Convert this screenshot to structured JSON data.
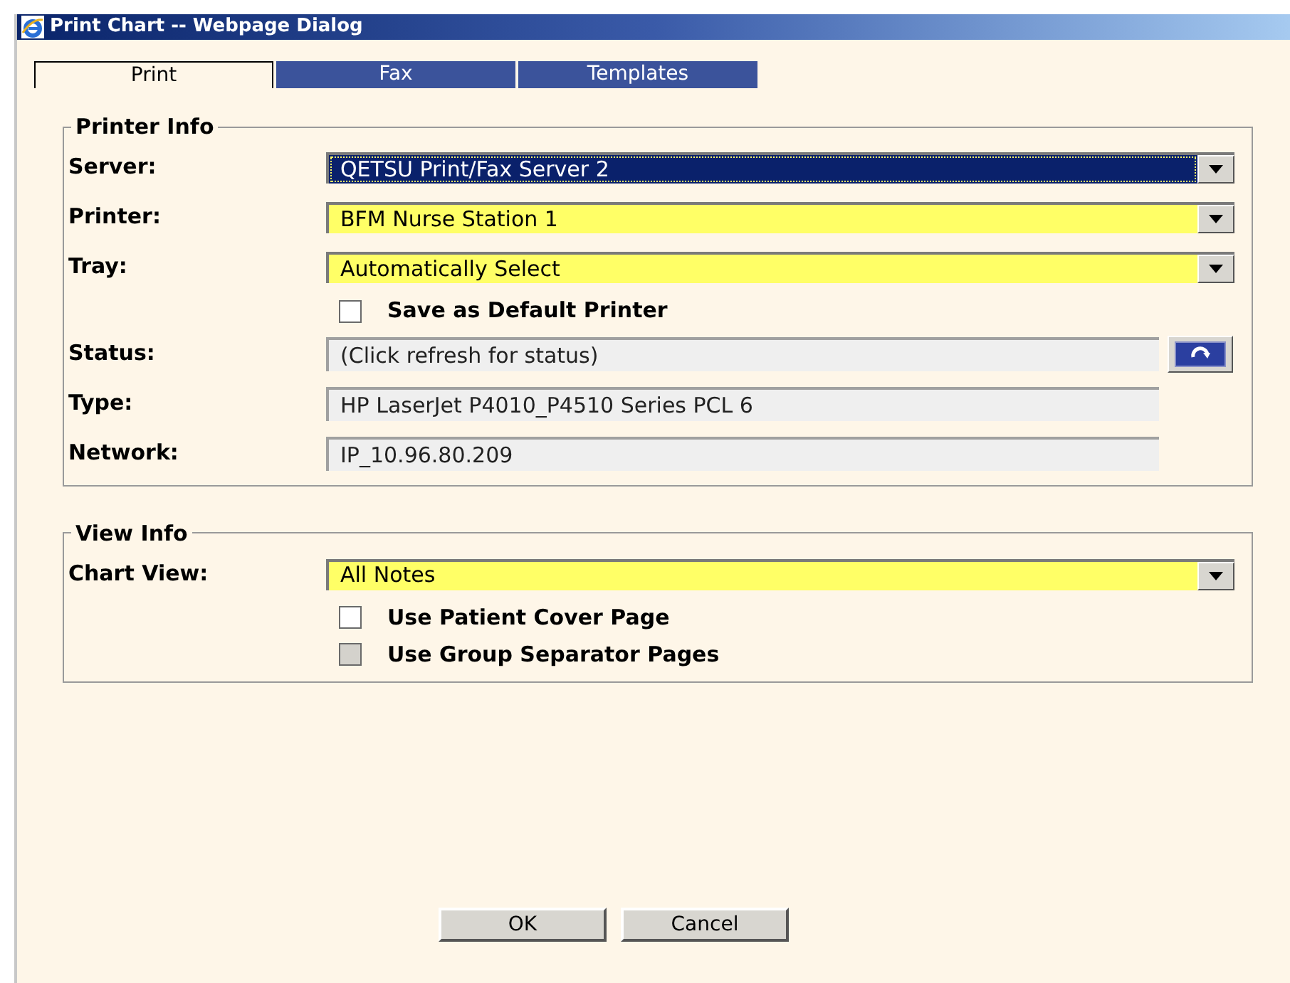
{
  "window": {
    "title": "Print Chart -- Webpage Dialog"
  },
  "tabs": [
    {
      "label": "Print",
      "selected": true
    },
    {
      "label": "Fax",
      "selected": false
    },
    {
      "label": "Templates",
      "selected": false
    }
  ],
  "printer_info": {
    "legend": "Printer Info",
    "rows": [
      {
        "kind": "select",
        "label": "Server:",
        "value": "QETSU Print/Fax Server 2",
        "highlighted": true
      },
      {
        "kind": "select",
        "label": "Printer:",
        "value": "BFM Nurse Station 1",
        "highlighted": false
      },
      {
        "kind": "select",
        "label": "Tray:",
        "value": "Automatically Select",
        "highlighted": false
      },
      {
        "kind": "checkbox",
        "label": "Save as Default Printer",
        "checked": false,
        "disabled": false
      },
      {
        "kind": "status",
        "label": "Status:",
        "value": "(Click refresh for status)"
      },
      {
        "kind": "readonly",
        "label": "Type:",
        "value": "HP LaserJet P4010_P4510 Series PCL 6"
      },
      {
        "kind": "readonly",
        "label": "Network:",
        "value": "IP_10.96.80.209"
      }
    ]
  },
  "view_info": {
    "legend": "View Info",
    "rows": [
      {
        "kind": "select",
        "label": "Chart View:",
        "value": "All Notes",
        "highlighted": false
      },
      {
        "kind": "checkbox",
        "label": "Use Patient Cover Page",
        "checked": false,
        "disabled": false
      },
      {
        "kind": "checkbox",
        "label": "Use Group Separator Pages",
        "checked": false,
        "disabled": true
      }
    ]
  },
  "buttons": [
    "OK",
    "Cancel"
  ]
}
